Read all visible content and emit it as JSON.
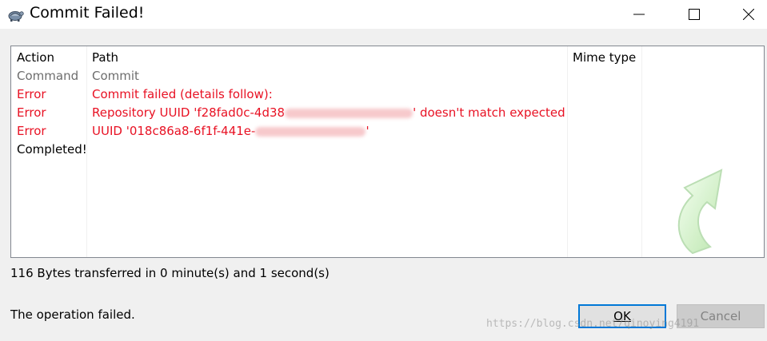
{
  "window": {
    "title": "Commit Failed!",
    "icon": "tortoise-icon"
  },
  "columns": {
    "action": "Action",
    "path": "Path",
    "mime": "Mime type"
  },
  "rows": [
    {
      "action": "Command",
      "path": "Commit",
      "color": "#6d6d6d"
    },
    {
      "action": "Error",
      "path": "Commit failed (details follow):",
      "color": "#e81123"
    },
    {
      "action": "Error",
      "path": "Repository UUID 'f28fad0c-4d38",
      "path_suffix": "' doesn't match expected",
      "color": "#e81123"
    },
    {
      "action": "Error",
      "path": " UUID '018c86a8-6f1f-441e-",
      "path_suffix": "'",
      "color": "#e81123"
    },
    {
      "action": "Completed!",
      "path": "",
      "color": "#000000"
    }
  ],
  "status": "116 Bytes transferred in 0 minute(s) and 1 second(s)",
  "result": "The operation failed.",
  "buttons": {
    "ok": "OK",
    "cancel": "Cancel"
  },
  "watermark": "https://blog.csdn.net/qinoying4191"
}
